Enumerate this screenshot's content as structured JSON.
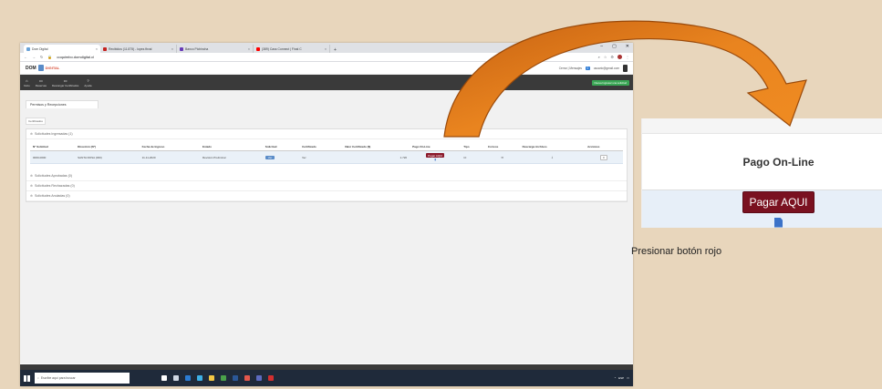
{
  "browser": {
    "tabs": [
      {
        "label": "Dom Digital",
        "color": "#6aa3d8"
      },
      {
        "label": "Recibidos (11.875) - lopez.fbval",
        "color": "#c5221f"
      },
      {
        "label": "Banco Pichincha",
        "color": "#673ab7"
      },
      {
        "label": "(389) Cass Connect | Final C",
        "color": "#ff0000"
      }
    ],
    "url": "coquimbo.domdigital.cl",
    "new_tab": "+"
  },
  "site": {
    "logo_text": "DOM",
    "logo_sub": "DIGITAL",
    "user_info": "Cerrar | Mensajes",
    "msg_count": "0",
    "user_email": "usuario@gmail.com"
  },
  "nav": {
    "items": [
      {
        "label": "Inicio",
        "icon": "home-icon"
      },
      {
        "label": "Reservas",
        "icon": "monitor-icon"
      },
      {
        "label": "Descargar Certificados",
        "icon": "monitor-icon"
      },
      {
        "label": "Ayuda",
        "icon": "help-icon"
      }
    ],
    "green_button": "Nueva Ingresar una solicitud"
  },
  "page": {
    "title": "Permisos y Recepciones",
    "subtab": "Certificados",
    "sections": [
      {
        "label": "Solicitudes Ingresadas (1)"
      },
      {
        "label": "Solicitudes Aprobadas (0)"
      },
      {
        "label": "Solicitudes Rechazadas (0)"
      },
      {
        "label": "Solicitudes Anuladas (0)"
      }
    ],
    "table": {
      "headers": [
        "Nº Solicitud",
        "Dirección (Nº)",
        "Fecha de Ingreso",
        "Estado",
        "Solicitud",
        "Certificado",
        "Valor Certificado ($)",
        "Pago On-Line",
        "Tipo",
        "Correos",
        "Descarga Archivos",
        "Acciones"
      ],
      "row": {
        "numero": "0000-0000",
        "direccion": "SANTA ROSA (000)",
        "fecha": "11-11-2020",
        "estado": "Revisión Preliminar",
        "solicitud": "Ver",
        "certificado": "Ver",
        "valor": "1.720",
        "pago": "Pagar AQUI",
        "tipo": "CI"
      }
    }
  },
  "taskbar": {
    "search_placeholder": "Escribe aquí para buscar",
    "tray_text": "ESP"
  },
  "zoom": {
    "header": "Pago On-Line",
    "button": "Pagar AQUI"
  },
  "caption": "Presionar botón rojo"
}
